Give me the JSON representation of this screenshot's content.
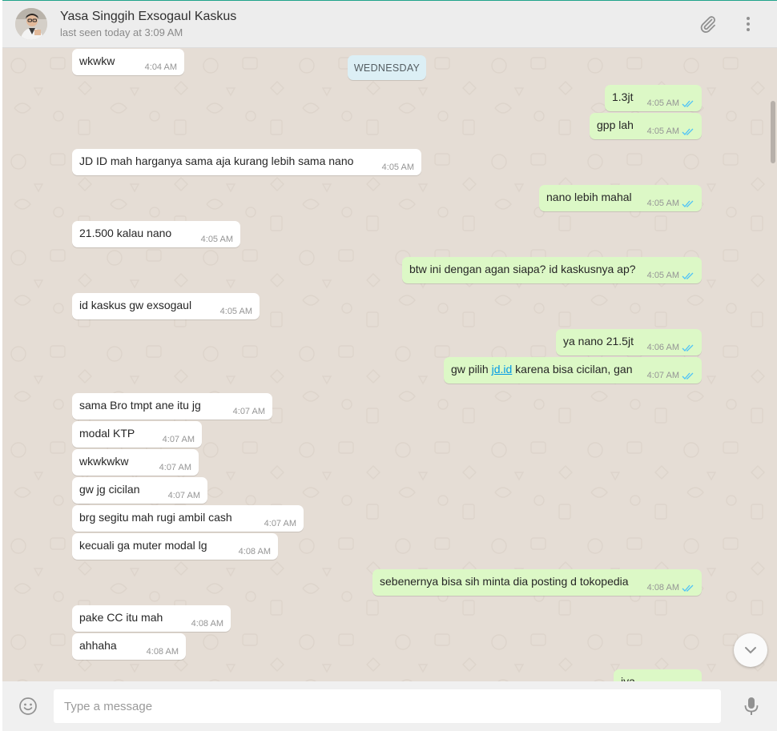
{
  "contact": {
    "name": "Yasa Singgih Exsogaul Kaskus",
    "status": "last seen today at 3:09 AM"
  },
  "header_icons": {
    "attach": "paperclip-icon",
    "menu": "kebab-menu-icon"
  },
  "date_divider": "WEDNESDAY",
  "messages": [
    {
      "dir": "in",
      "text": "wkwkw",
      "time": "4:04 AM"
    },
    {
      "dir": "out",
      "text": "1.3jt",
      "time": "4:05 AM"
    },
    {
      "dir": "out",
      "text": "gpp lah",
      "time": "4:05 AM"
    },
    {
      "dir": "in",
      "text": "JD ID mah harganya sama aja kurang lebih sama nano",
      "time": "4:05 AM"
    },
    {
      "dir": "out",
      "text": "nano lebih mahal",
      "time": "4:05 AM"
    },
    {
      "dir": "in",
      "text": "21.500 kalau nano",
      "time": "4:05 AM"
    },
    {
      "dir": "out",
      "text": "btw ini dengan agan siapa? id kaskusnya ap?",
      "time": "4:05 AM"
    },
    {
      "dir": "in",
      "text": "id kaskus gw exsogaul",
      "time": "4:05 AM"
    },
    {
      "dir": "out",
      "text": "ya nano 21.5jt",
      "time": "4:06 AM"
    },
    {
      "dir": "out",
      "text_before": "gw pilih ",
      "link": "jd.id",
      "text_after": " karena bisa cicilan, gan",
      "time": "4:07 AM"
    },
    {
      "dir": "in",
      "text": "sama Bro tmpt ane itu jg",
      "time": "4:07 AM"
    },
    {
      "dir": "in",
      "text": "modal KTP",
      "time": "4:07 AM"
    },
    {
      "dir": "in",
      "text": "wkwkwkw",
      "time": "4:07 AM"
    },
    {
      "dir": "in",
      "text": "gw jg cicilan",
      "time": "4:07 AM"
    },
    {
      "dir": "in",
      "text": "brg segitu mah rugi ambil cash",
      "time": "4:07 AM"
    },
    {
      "dir": "in",
      "text": "kecuali ga muter modal lg",
      "time": "4:08 AM"
    },
    {
      "dir": "out",
      "text": "sebenernya bisa sih minta dia posting d tokopedia",
      "time": "4:08 AM"
    },
    {
      "dir": "in",
      "text": "pake CC itu mah",
      "time": "4:08 AM"
    },
    {
      "dir": "in",
      "text": "ahhaha",
      "time": "4:08 AM"
    },
    {
      "dir": "out",
      "text": "iya",
      "time": ""
    }
  ],
  "composer": {
    "placeholder": "Type a message",
    "emoji_icon": "smiley-icon",
    "mic_icon": "microphone-icon"
  },
  "colors": {
    "incoming": "#ffffff",
    "outgoing": "#dcf8c6",
    "wallpaper": "#e5ddd5",
    "read_ticks": "#4fc3f7",
    "link": "#039be5"
  }
}
